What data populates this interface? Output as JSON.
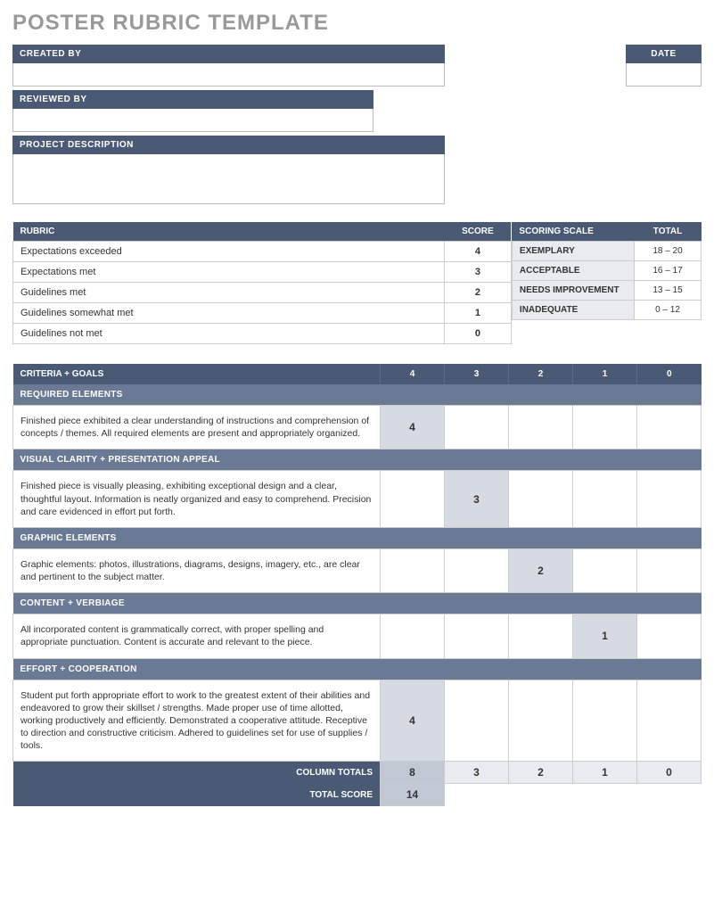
{
  "title": "POSTER RUBRIC TEMPLATE",
  "fields": {
    "created_by_label": "CREATED BY",
    "created_by_value": "",
    "reviewed_by_label": "REVIEWED BY",
    "reviewed_by_value": "",
    "project_desc_label": "PROJECT DESCRIPTION",
    "project_desc_value": "",
    "date_label": "DATE",
    "date_value": ""
  },
  "rubric_legend": {
    "header_rubric": "RUBRIC",
    "header_score": "SCORE",
    "rows": [
      {
        "label": "Expectations exceeded",
        "score": "4"
      },
      {
        "label": "Expectations met",
        "score": "3"
      },
      {
        "label": "Guidelines met",
        "score": "2"
      },
      {
        "label": "Guidelines somewhat met",
        "score": "1"
      },
      {
        "label": "Guidelines not met",
        "score": "0"
      }
    ]
  },
  "scoring_scale": {
    "header_scale": "SCORING SCALE",
    "header_total": "TOTAL",
    "rows": [
      {
        "label": "EXEMPLARY",
        "range": "18 – 20"
      },
      {
        "label": "ACCEPTABLE",
        "range": "16 – 17"
      },
      {
        "label": "NEEDS IMPROVEMENT",
        "range": "13 – 15"
      },
      {
        "label": "INADEQUATE",
        "range": "0 – 12"
      }
    ]
  },
  "criteria": {
    "header_label": "CRITERIA + GOALS",
    "cols": [
      "4",
      "3",
      "2",
      "1",
      "0"
    ],
    "sections": [
      {
        "title": "REQUIRED ELEMENTS",
        "desc": "Finished piece exhibited a clear understanding of instructions and comprehension of concepts / themes.  All required elements are present and appropriately organized.",
        "scores": [
          "4",
          "",
          "",
          "",
          ""
        ]
      },
      {
        "title": "VISUAL CLARITY + PRESENTATION APPEAL",
        "desc": "Finished piece is visually pleasing, exhibiting exceptional design and a clear, thoughtful layout.  Information is neatly organized and easy to comprehend.  Precision and care evidenced in effort put forth.",
        "scores": [
          "",
          "3",
          "",
          "",
          ""
        ]
      },
      {
        "title": "GRAPHIC ELEMENTS",
        "desc": "Graphic elements: photos, illustrations, diagrams, designs, imagery, etc., are clear and pertinent to the subject matter.",
        "scores": [
          "",
          "",
          "2",
          "",
          ""
        ]
      },
      {
        "title": "CONTENT + VERBIAGE",
        "desc": "All incorporated content is grammatically correct, with proper spelling and appropriate punctuation.  Content is accurate and relevant to the piece.",
        "scores": [
          "",
          "",
          "",
          "1",
          ""
        ]
      },
      {
        "title": "EFFORT + COOPERATION",
        "desc": "Student put forth appropriate effort to work to the greatest extent of their abilities and endeavored to grow their skillset / strengths.  Made proper use of time allotted, working productively and efficiently.  Demonstrated a cooperative attitude.  Receptive to direction and constructive criticism.  Adhered to guidelines set for use of supplies / tools.",
        "scores": [
          "4",
          "",
          "",
          "",
          ""
        ]
      }
    ],
    "column_totals_label": "COLUMN TOTALS",
    "column_totals": [
      "8",
      "3",
      "2",
      "1",
      "0"
    ],
    "total_score_label": "TOTAL SCORE",
    "total_score": "14"
  }
}
